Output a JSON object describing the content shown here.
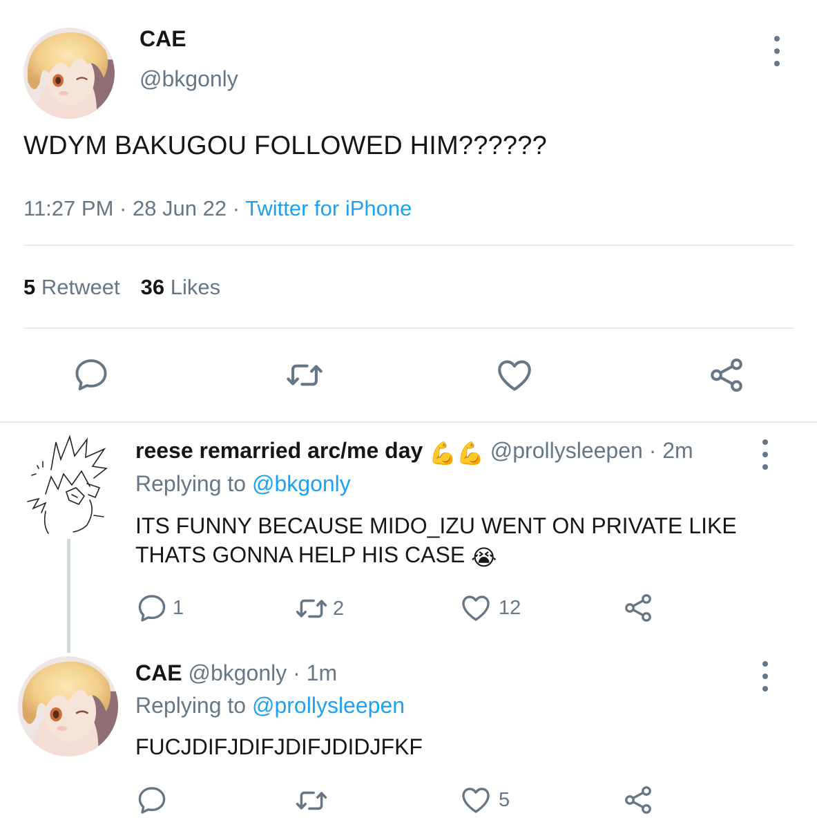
{
  "tweet": {
    "display_name": "CAE",
    "handle": "@bkgonly",
    "text": "WDYM BAKUGOU FOLLOWED HIM??????",
    "time": "11:27 PM",
    "sep1": " · ",
    "date": "28 Jun 22",
    "sep2": " · ",
    "source": "Twitter for iPhone",
    "retweet_count": "5",
    "retweet_label": "Retweet",
    "like_count": "36",
    "like_label": "Likes"
  },
  "replies": [
    {
      "display_name": "reese remarried arc/me day",
      "emoji": "💪💪",
      "handle": "@prollysleepen",
      "time_sep": " · ",
      "time": "2m",
      "replying_prefix": "Replying to ",
      "replying_to": "@bkgonly",
      "text": "ITS FUNNY BECAUSE MIDO_IZU WENT ON PRIVATE LIKE THATS GONNA HELP HIS CASE",
      "text_emoji": "😭",
      "reply_count": "1",
      "retweet_count": "2",
      "like_count": "12"
    },
    {
      "display_name": "CAE",
      "handle": "@bkgonly",
      "time_sep": " · ",
      "time": "1m",
      "replying_prefix": "Replying to ",
      "replying_to": "@prollysleepen",
      "text": "FUCJDIFJDIFJDIFJDIDJFKF",
      "reply_count": "",
      "retweet_count": "",
      "like_count": "5"
    }
  ],
  "colors": {
    "link": "#1da1f2",
    "secondary": "#657786",
    "primary_text": "#14171a",
    "divider": "#e6ecf0"
  },
  "icons": [
    "more-icon",
    "reply-icon",
    "retweet-icon",
    "like-icon",
    "share-icon"
  ]
}
